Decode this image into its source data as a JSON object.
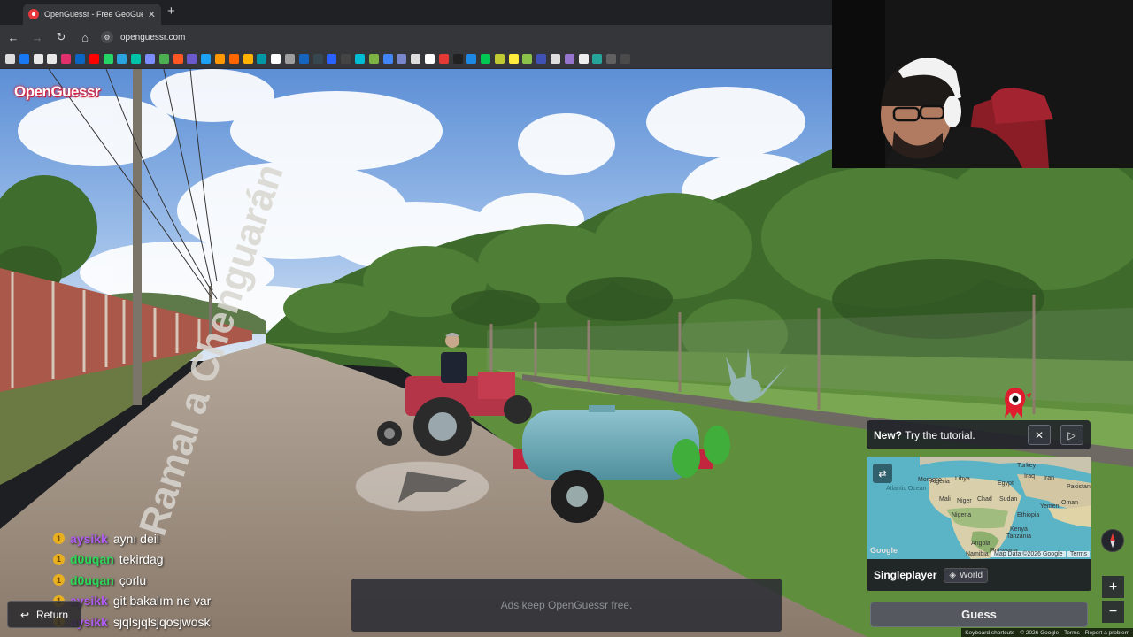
{
  "browser": {
    "tab_title": "OpenGuessr - Free GeoGuessr Alternative",
    "tab_close": "✕",
    "new_tab": "+",
    "back": "←",
    "forward": "→",
    "reload": "↻",
    "home": "⌂",
    "site_info": "⚙",
    "url": "openguessr.com",
    "bookmark_colors": [
      "#dddddd",
      "#1877f2",
      "#e8e8e8",
      "#e8e8e8",
      "#e1306c",
      "#0a66c2",
      "#ff0000",
      "#25d366",
      "#2aa3df",
      "#00c2a8",
      "#7a8cff",
      "#4caf50",
      "#ff5722",
      "#6a5acd",
      "#1da1f2",
      "#ff9800",
      "#ff6600",
      "#ffb300",
      "#0097a7",
      "#ffffff",
      "#9e9e9e",
      "#1565c0",
      "#37474f",
      "#2962ff",
      "#444444",
      "#00bcd4",
      "#7cb342",
      "#4285f4",
      "#7986cb",
      "#dddddd",
      "#ffffff",
      "#e53935",
      "#212121",
      "#1e88e5",
      "#00c853",
      "#c0ca33",
      "#ffeb3b",
      "#8bc34a",
      "#3f51b5",
      "#dddddd",
      "#9575cd",
      "#eeeeee",
      "#26a69a",
      "#616161",
      "#4a4a4a"
    ]
  },
  "app": {
    "logo": "OpenGuessr"
  },
  "street_sign": "Ramal a Chenguarán",
  "chat": [
    {
      "badge": "1",
      "user": "aysikk",
      "message": "aynı deil",
      "color": "#b05cf0"
    },
    {
      "badge": "1",
      "user": "d0uqan",
      "message": "tekirdag",
      "color": "#2ed95a"
    },
    {
      "badge": "1",
      "user": "d0uqan",
      "message": "çorlu",
      "color": "#2ed95a"
    },
    {
      "badge": "1",
      "user": "aysikk",
      "message": "git bakalım ne var",
      "color": "#b05cf0"
    },
    {
      "badge": "1",
      "user": "aysikk",
      "message": "sjqlsjqlsjqosjwosk",
      "color": "#b05cf0"
    }
  ],
  "return_button": {
    "icon": "↩",
    "label": "Return"
  },
  "ad_text": "Ads keep OpenGuessr free.",
  "tutorial": {
    "prefix": "New?",
    "text": "Try the tutorial.",
    "close": "✕",
    "play": "▷"
  },
  "map": {
    "swap_icon": "⇄",
    "watermark": "Google",
    "credit": "Map Data ©2026 Google",
    "terms": "Terms",
    "labels": [
      "Algeria",
      "Libya",
      "Egypt",
      "Mali",
      "Niger",
      "Chad",
      "Sudan",
      "Nigeria",
      "Ethiopia",
      "Kenya",
      "Angola",
      "Tanzania",
      "Iraq",
      "Iran",
      "Pakistan",
      "Oman",
      "Yemen",
      "Morocco",
      "Namibia",
      "Botswana",
      "Turkey",
      "Atlantic Ocean"
    ]
  },
  "mode": {
    "label": "Singleplayer",
    "world_icon": "◈",
    "world": "World"
  },
  "guess_button": "Guess",
  "zoom": {
    "in": "+",
    "out": "−"
  },
  "footer": {
    "shortcuts": "Keyboard shortcuts",
    "copyright": "© 2026 Google",
    "terms": "Terms",
    "report": "Report a problem"
  }
}
